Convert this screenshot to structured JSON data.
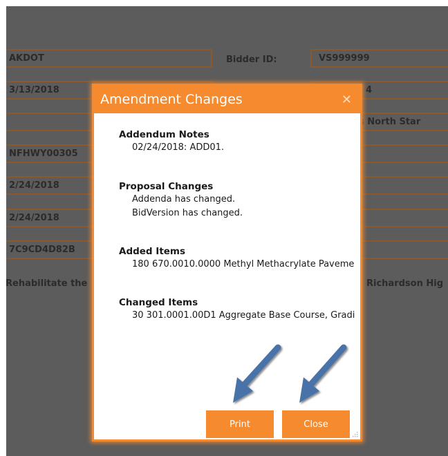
{
  "background_form": {
    "fields_left": [
      "AKDOT",
      "3/13/2018",
      "",
      "NFHWY00305",
      "2/24/2018",
      "2/24/2018",
      "7C9CD4D82B"
    ],
    "bidder_id_label": "Bidder ID:",
    "bidder_id_value": "VS999999",
    "right_value_2": "4",
    "right_value_3": "s North Star",
    "description_left": "Rehabilitate the",
    "description_right": "Richardson Hig"
  },
  "dialog": {
    "title": "Amendment Changes",
    "close_glyph": "✕",
    "sections": [
      {
        "title": "Addendum Notes",
        "lines": [
          "02/24/2018: ADD01."
        ]
      },
      {
        "title": "Proposal Changes",
        "lines": [
          "Addenda has changed.",
          "BidVersion has changed."
        ]
      },
      {
        "title": "Added Items",
        "lines": [
          "180 670.0010.0000 Methyl Methacrylate Paveme"
        ]
      },
      {
        "title": "Changed Items",
        "lines": [
          "30 301.0001.00D1 Aggregate Base Course, Gradi"
        ]
      }
    ],
    "print_label": "Print",
    "close_label": "Close"
  },
  "colors": {
    "accent": "#f58a2f",
    "overlay": "#5c5c5c",
    "field_border": "#8a5a2c",
    "annotation_arrow": "#4a72a8"
  }
}
